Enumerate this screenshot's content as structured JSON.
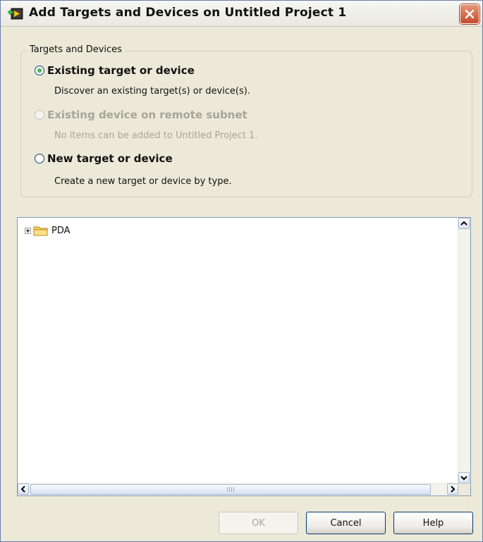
{
  "window": {
    "title": "Add Targets and Devices on Untitled Project 1"
  },
  "group": {
    "legend": "Targets and Devices",
    "options": [
      {
        "label": "Existing target or device",
        "description": "Discover an existing target(s) or device(s).",
        "selected": true,
        "enabled": true
      },
      {
        "label": "Existing device on remote subnet",
        "description": "No items can be added to Untitled Project 1.",
        "selected": false,
        "enabled": false
      },
      {
        "label": "New target or device",
        "description": "Create a new target or device by type.",
        "selected": false,
        "enabled": true
      }
    ]
  },
  "tree": {
    "items": [
      {
        "label": "PDA",
        "icon": "folder-icon",
        "expandable": true
      }
    ]
  },
  "buttons": {
    "ok": "OK",
    "cancel": "Cancel",
    "help": "Help"
  },
  "colors": {
    "accent": "#003c74",
    "selected_radio": "#1d8f1d",
    "disabled_text": "#a7a59a"
  }
}
